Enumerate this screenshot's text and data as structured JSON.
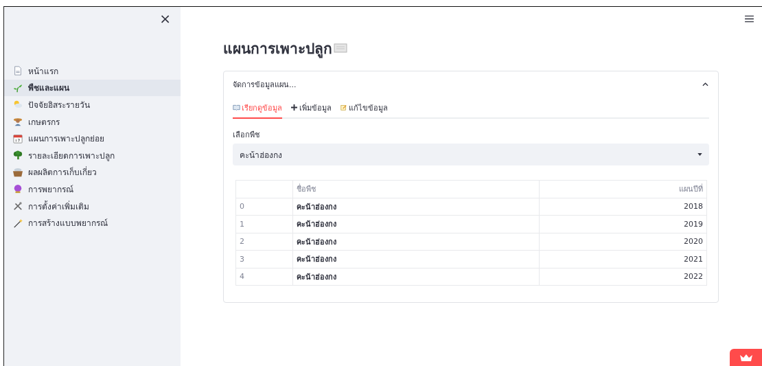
{
  "sidebar": {
    "close": "×",
    "items": [
      {
        "label": "หน้าแรก",
        "selected": false
      },
      {
        "label": "พืชและแผน",
        "selected": true
      },
      {
        "label": "ปัจจัยอิสระรายวัน",
        "selected": false
      },
      {
        "label": "เกษตรกร",
        "selected": false
      },
      {
        "label": "แผนการเพาะปลูกย่อย",
        "selected": false
      },
      {
        "label": "รายละเอียดการเพาะปลูก",
        "selected": false
      },
      {
        "label": "ผลผลิตการเก็บเกี่ยว",
        "selected": false
      },
      {
        "label": "การพยากรณ์",
        "selected": false
      },
      {
        "label": "การตั้งค่าเพิ่มเติม",
        "selected": false
      },
      {
        "label": "การสร้างแบบพยากรณ์",
        "selected": false
      }
    ]
  },
  "page_title": "แผนการเพาะปลูก",
  "expander": {
    "title": "จัดการข้อมูลแผน...",
    "expanded": true,
    "tabs": [
      {
        "label": "เรียกดูข้อมูล",
        "selected": true
      },
      {
        "label": "เพิ่มข้อมูล",
        "selected": false
      },
      {
        "label": "แก้ไขข้อมูล",
        "selected": false
      }
    ],
    "select": {
      "label": "เลือกพืช",
      "value": "คะน้าฮ่องกง"
    },
    "table": {
      "columns": [
        "ชื่อพืช",
        "แผนปีที่"
      ],
      "rows": [
        {
          "index": "0",
          "crop": "คะน้าฮ่องกง",
          "plan_year": "2018"
        },
        {
          "index": "1",
          "crop": "คะน้าฮ่องกง",
          "plan_year": "2019"
        },
        {
          "index": "2",
          "crop": "คะน้าฮ่องกง",
          "plan_year": "2020"
        },
        {
          "index": "3",
          "crop": "คะน้าฮ่องกง",
          "plan_year": "2021"
        },
        {
          "index": "4",
          "crop": "คะน้าฮ่องกง",
          "plan_year": "2022"
        }
      ]
    }
  }
}
